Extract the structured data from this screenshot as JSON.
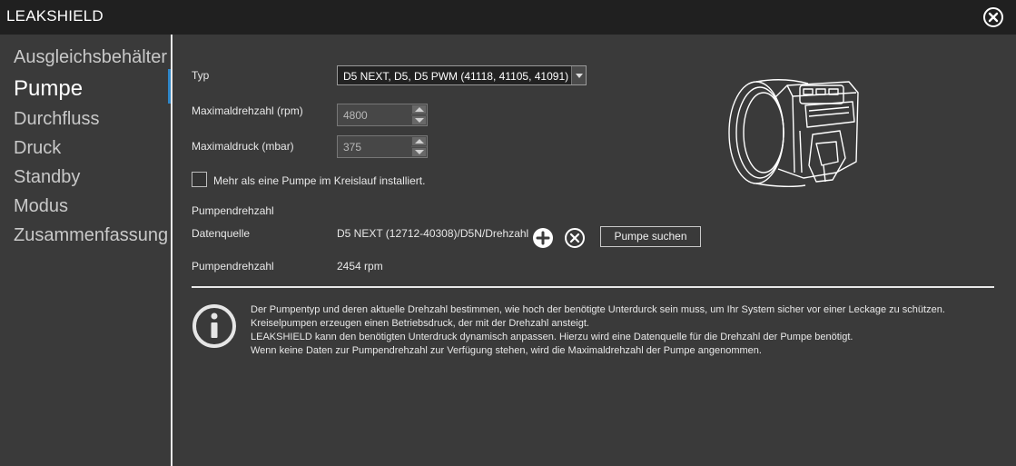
{
  "window": {
    "title": "LEAKSHIELD"
  },
  "sidebar": {
    "items": [
      {
        "label": "Ausgleichsbehälter",
        "active": false
      },
      {
        "label": "Pumpe",
        "active": true
      },
      {
        "label": "Durchfluss",
        "active": false
      },
      {
        "label": "Druck",
        "active": false
      },
      {
        "label": "Standby",
        "active": false
      },
      {
        "label": "Modus",
        "active": false
      },
      {
        "label": "Zusammenfassung",
        "active": false
      }
    ]
  },
  "pump": {
    "type_label": "Typ",
    "type_value": "D5 NEXT, D5, D5 PWM (41118, 41105, 41091)",
    "max_rpm_label": "Maximaldrehzahl (rpm)",
    "max_rpm_value": "4800",
    "max_pressure_label": "Maximaldruck (mbar)",
    "max_pressure_value": "375",
    "multi_pump_label": "Mehr als eine Pumpe im Kreislauf installiert.",
    "multi_pump_checked": false
  },
  "speed": {
    "section_title": "Pumpendrehzahl",
    "source_label": "Datenquelle",
    "source_value": "D5 NEXT (12712-40308)/D5N/Drehzahl",
    "search_button": "Pumpe suchen",
    "speed_label": "Pumpendrehzahl",
    "speed_value": "2454 rpm"
  },
  "info": {
    "lines": [
      "Der Pumpentyp und deren aktuelle Drehzahl bestimmen, wie hoch der benötigte Unterdurck sein muss, um Ihr System sicher vor einer Leckage zu schützen.",
      "Kreiselpumpen erzeugen einen Betriebsdruck, der mit der Drehzahl ansteigt.",
      "LEAKSHIELD kann den benötigten Unterdruck dynamisch anpassen. Hierzu wird eine Datenquelle für die Drehzahl der Pumpe benötigt.",
      "Wenn keine Daten zur Pumpendrehzahl zur Verfügung stehen, wird die Maximaldrehzahl der Pumpe angenommen."
    ]
  },
  "colors": {
    "accent": "#2e86c8",
    "titlebar": "#202020",
    "background": "#3a3a3a"
  }
}
